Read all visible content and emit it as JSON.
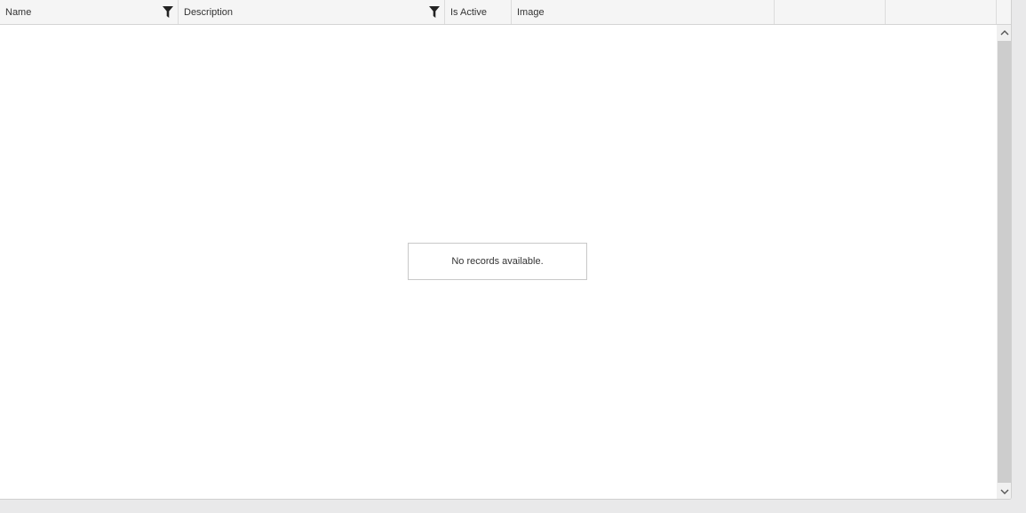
{
  "grid": {
    "columns": [
      {
        "label": "Name",
        "filter_icon": "filter-icon"
      },
      {
        "label": "Description",
        "filter_icon": "filter-icon"
      },
      {
        "label": "Is Active"
      },
      {
        "label": "Image"
      },
      {
        "label": ""
      },
      {
        "label": ""
      }
    ],
    "empty_message": "No records available."
  },
  "colors": {
    "header_bg": "#f5f5f5",
    "border": "#d4d4d4",
    "scroll_thumb": "#cdcdcd"
  }
}
